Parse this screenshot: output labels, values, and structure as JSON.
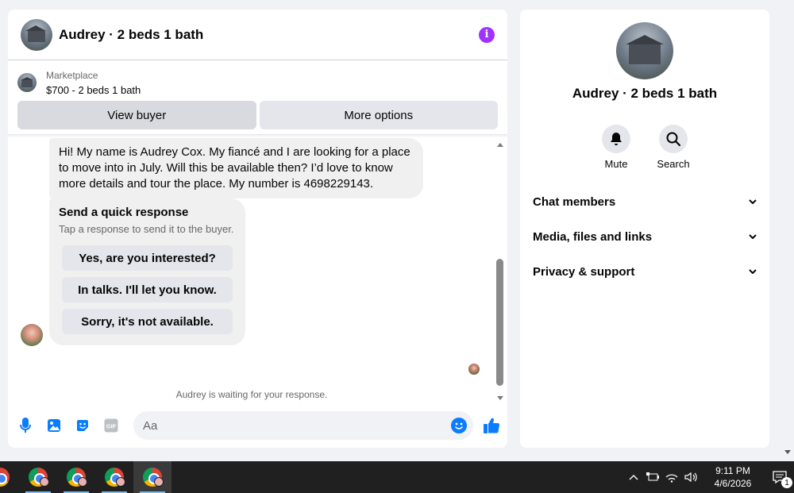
{
  "chat": {
    "title": "Audrey · 2 beds 1 bath",
    "listing": {
      "label": "Marketplace",
      "detail": "$700 - 2 beds 1 bath",
      "view_buyer": "View buyer",
      "more_options": "More options"
    },
    "messages": {
      "first": "Hi! My name is Audrey Cox. My fiancé and I are looking for a place to move into in July. Will this be available then? I’d love to know more details and tour the place. My number is 4698229143.",
      "quick_title": "Send a quick response",
      "quick_subtitle": "Tap a response to send it to the buyer.",
      "quick_options": [
        "Yes, are you interested?",
        "In talks. I'll let you know.",
        "Sorry, it's not available."
      ]
    },
    "waiting_text": "Audrey is waiting for your response.",
    "composer": {
      "placeholder": "Aa",
      "gif_label": "GIF"
    }
  },
  "side": {
    "name": "Audrey · 2 beds 1 bath",
    "actions": [
      {
        "label": "Mute",
        "icon": "bell-icon"
      },
      {
        "label": "Search",
        "icon": "search-icon"
      }
    ],
    "sections": [
      "Chat members",
      "Media, files and links",
      "Privacy & support"
    ]
  },
  "taskbar": {
    "time": "9:11 PM",
    "date": "4/6/2026",
    "notification_count": "1"
  },
  "colors": {
    "accent_blue": "#0a7cff",
    "info_purple": "#a033ff",
    "bubble_grey": "#f0f0f0",
    "button_grey": "#e4e6eb"
  }
}
